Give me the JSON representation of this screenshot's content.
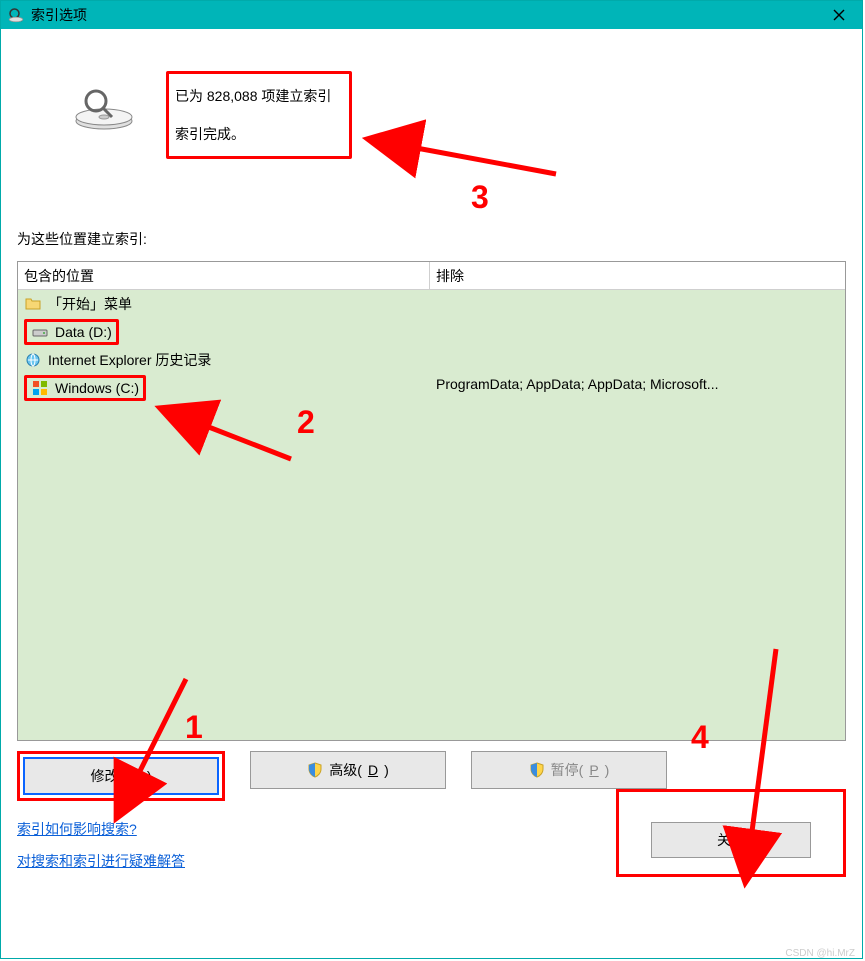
{
  "titlebar": {
    "title": "索引选项"
  },
  "status": {
    "line1_prefix": "已为 ",
    "count": "828,088",
    "line1_suffix": " 项建立索引",
    "line2": "索引完成。"
  },
  "section_label": "为这些位置建立索引:",
  "columns": {
    "included": "包含的位置",
    "excluded": "排除"
  },
  "rows": {
    "start_menu": "「开始」菜单",
    "data_d": "Data (D:)",
    "ie_history": "Internet Explorer 历史记录",
    "windows_c": "Windows (C:)"
  },
  "exclude_text": "ProgramData; AppData; AppData; Microsoft...",
  "buttons": {
    "modify": "修改(",
    "modify_u": "M",
    "modify_end": ")",
    "advanced": "高级(",
    "advanced_u": "D",
    "advanced_end": ")",
    "pause": "暂停(",
    "pause_u": "P",
    "pause_end": ")",
    "close": "关闭"
  },
  "links": {
    "how": "索引如何影响搜索?",
    "troubleshoot": "对搜索和索引进行疑难解答"
  },
  "annotations": {
    "n1": "1",
    "n2": "2",
    "n3": "3",
    "n4": "4"
  },
  "watermark": "CSDN @hi.MrZ"
}
